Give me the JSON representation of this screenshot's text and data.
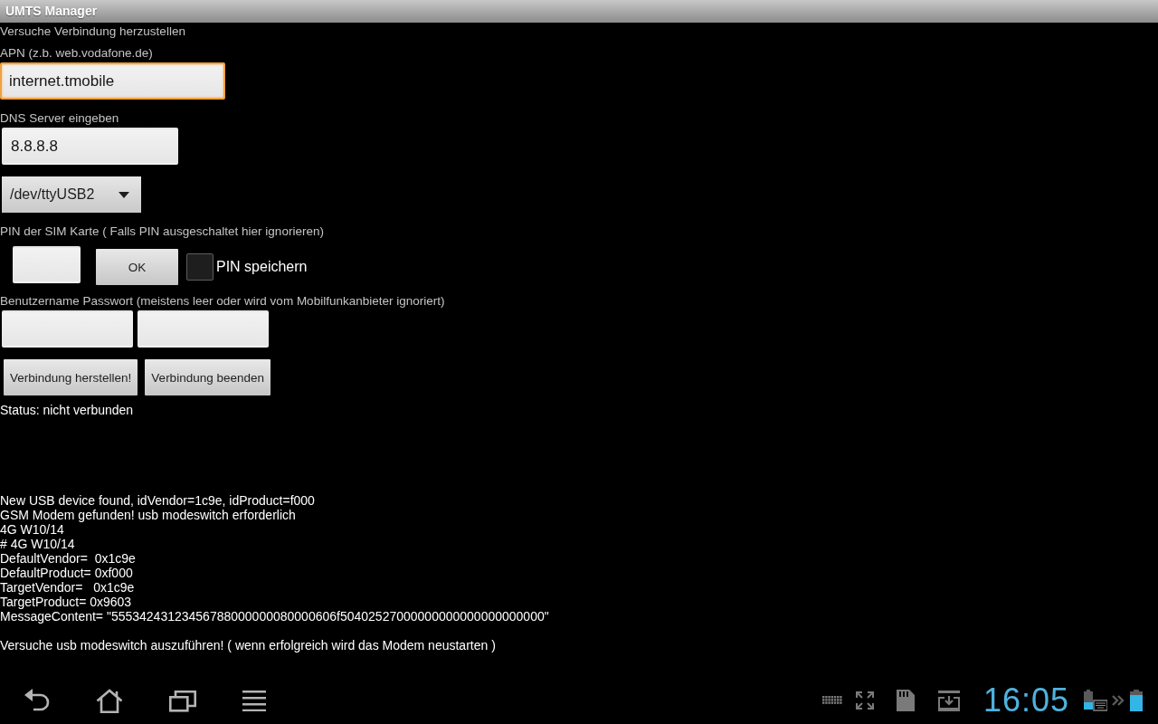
{
  "window": {
    "title": "UMTS Manager"
  },
  "form": {
    "message": "Versuche Verbindung herzustellen",
    "apn": {
      "label": "APN (z.b. web.vodafone.de)",
      "value": "internet.tmobile",
      "focused": true
    },
    "dns": {
      "label": "DNS Server eingeben",
      "value": "8.8.8.8",
      "focused": false
    },
    "device": {
      "value": "/dev/ttyUSB2"
    },
    "pin": {
      "label": "PIN der SIM Karte ( Falls PIN ausgeschaltet hier ignorieren)",
      "field": {
        "focused": false
      },
      "button": "OK",
      "save_checkbox": {
        "label": "PIN speichern",
        "checked": false
      }
    },
    "credentials": {
      "label": "Benutzername Passwort (meistens leer oder wird vom Mobilfunkanbieter ignoriert)",
      "username": {
        "focused": false
      },
      "password": {
        "focused": false
      }
    },
    "buttons": [
      {
        "label": "Verbindung herstellen!"
      },
      {
        "label": "Verbindung beenden"
      }
    ],
    "status": "Status: nicht verbunden"
  },
  "log": [
    {
      "lines": [
        "New USB device found, idVendor=1c9e, idProduct=f000",
        "GSM Modem gefunden! usb modeswitch erforderlich",
        "4G W10/14",
        "# 4G W10/14",
        "DefaultVendor=  0x1c9e",
        "DefaultProduct= 0xf000",
        "TargetVendor=   0x1c9e",
        "TargetProduct= 0x9603",
        "MessageContent= \"55534243123456788000000080000606f50402527000000000000000000000\""
      ]
    },
    {
      "lines": [
        "Versuche usb modeswitch auszuführen! ( wenn erfolgreich wird das Modem neustarten )"
      ]
    }
  ],
  "status_bar": {
    "clock": "16:05"
  }
}
